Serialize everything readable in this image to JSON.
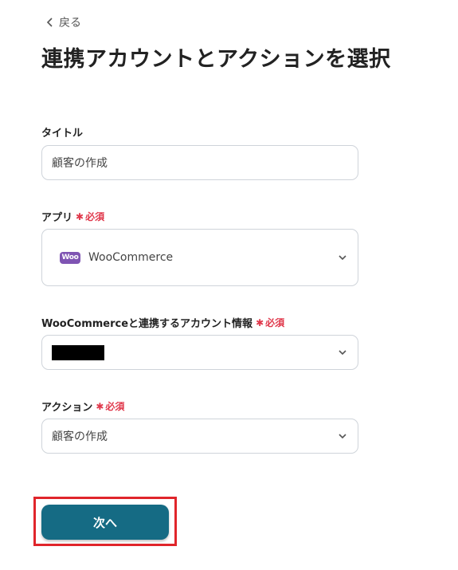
{
  "back": {
    "label": "戻る"
  },
  "page": {
    "title": "連携アカウントとアクションを選択"
  },
  "required_label": "必須",
  "fields": {
    "title": {
      "label": "タイトル",
      "value": "顧客の作成"
    },
    "app": {
      "label": "アプリ",
      "value": "WooCommerce",
      "logo_text": "Woo"
    },
    "account": {
      "label": "WooCommerceと連携するアカウント情報"
    },
    "action": {
      "label": "アクション",
      "value": "顧客の作成"
    }
  },
  "next_button": {
    "label": "次へ"
  },
  "colors": {
    "primary": "#156b84",
    "required": "#e0384b",
    "highlight": "#e0252b",
    "woo": "#7f54b3"
  }
}
